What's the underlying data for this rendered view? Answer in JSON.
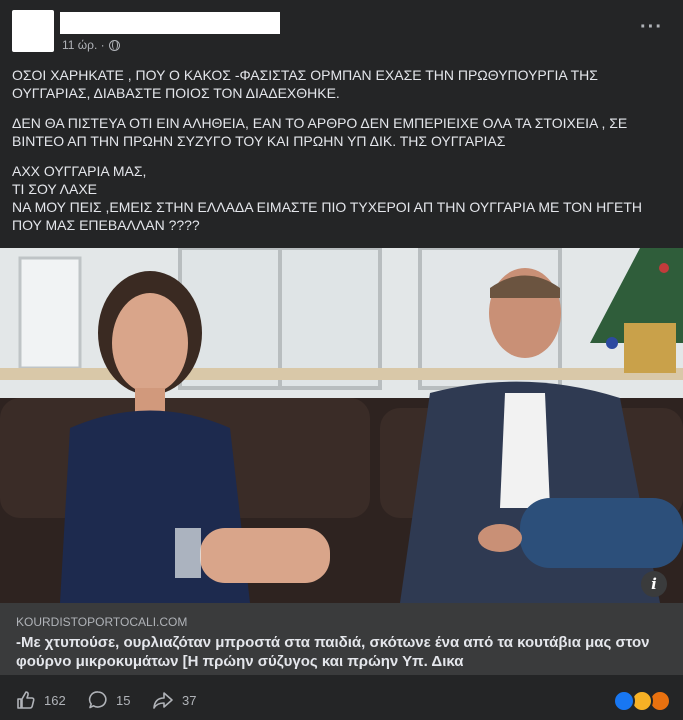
{
  "post": {
    "time": "11 ώρ. ·",
    "paragraphs": [
      "ΟΣΟΙ ΧΑΡΗΚΑΤΕ , ΠΟΥ Ο ΚΑΚΟΣ -ΦΑΣΙΣΤΑΣ ΟΡΜΠΑΝ ΕΧΑΣΕ ΤΗΝ ΠΡΩΘΥΠΟΥΡΓΙΑ ΤΗΣ ΟΥΓΓΑΡΙΑΣ, ΔΙΑΒΑΣΤΕ ΠΟΙΟΣ ΤΟΝ ΔΙΑΔΕΧΘΗΚΕ.",
      "ΔΕΝ ΘΑ ΠΙΣΤΕΥΑ ΟΤΙ ΕΙΝ ΑΛΗΘΕΙΑ, ΕΑΝ ΤΟ ΑΡΘΡΟ ΔΕΝ ΕΜΠΕΡΙΕΙΧΕ ΟΛΑ ΤΑ ΣΤΟΙΧΕΙΑ , ΣΕ ΒΙΝΤΕΟ ΑΠ ΤΗΝ ΠΡΩΗΝ ΣΥΖΥΓΟ ΤΟΥ ΚΑΙ ΠΡΩΗΝ ΥΠ ΔΙΚ. ΤΗΣ ΟΥΓΓΑΡΙΑΣ",
      "ΑΧΧ ΟΥΓΓΑΡΙΑ ΜΑΣ,\nΤΙ ΣΟΥ ΛΑΧΕ\nΝΑ ΜΟΥ ΠΕΙΣ ,ΕΜΕΙΣ ΣΤΗΝ ΕΛΛΑΔΑ ΕΙΜΑΣΤΕ ΠΙΟ ΤΥΧΕΡΟΙ ΑΠ ΤΗΝ ΟΥΓΓΑΡΙΑ ΜΕ ΤΟΝ ΗΓΕΤΗ ΠΟΥ ΜΑΣ ΕΠΕΒΑΛΛΑΝ ????"
    ]
  },
  "link": {
    "domain": "KOURDISTOPORTOCALI.COM",
    "title": "-Με χτυπούσε, ουρλιαζόταν μπροστά στα παιδιά, σκότωνε ένα από τα κουτάβια μας στον φούρνο μικροκυμάτων [Η πρώην σύζυγος και πρώην Υπ. Δικα"
  },
  "footer": {
    "likes": "162",
    "comments": "15",
    "shares": "37"
  },
  "icons": {
    "globe": "globe-icon",
    "more": "more-options-icon",
    "info": "info-icon",
    "like": "thumbs-up-icon",
    "comment": "comment-icon",
    "share": "share-icon"
  },
  "colors": {
    "background": "#242526",
    "link_box": "#3a3b3c",
    "like_blue": "#1877f2",
    "haha_yellow": "#f7b125",
    "angry_red": "#e9710f"
  }
}
